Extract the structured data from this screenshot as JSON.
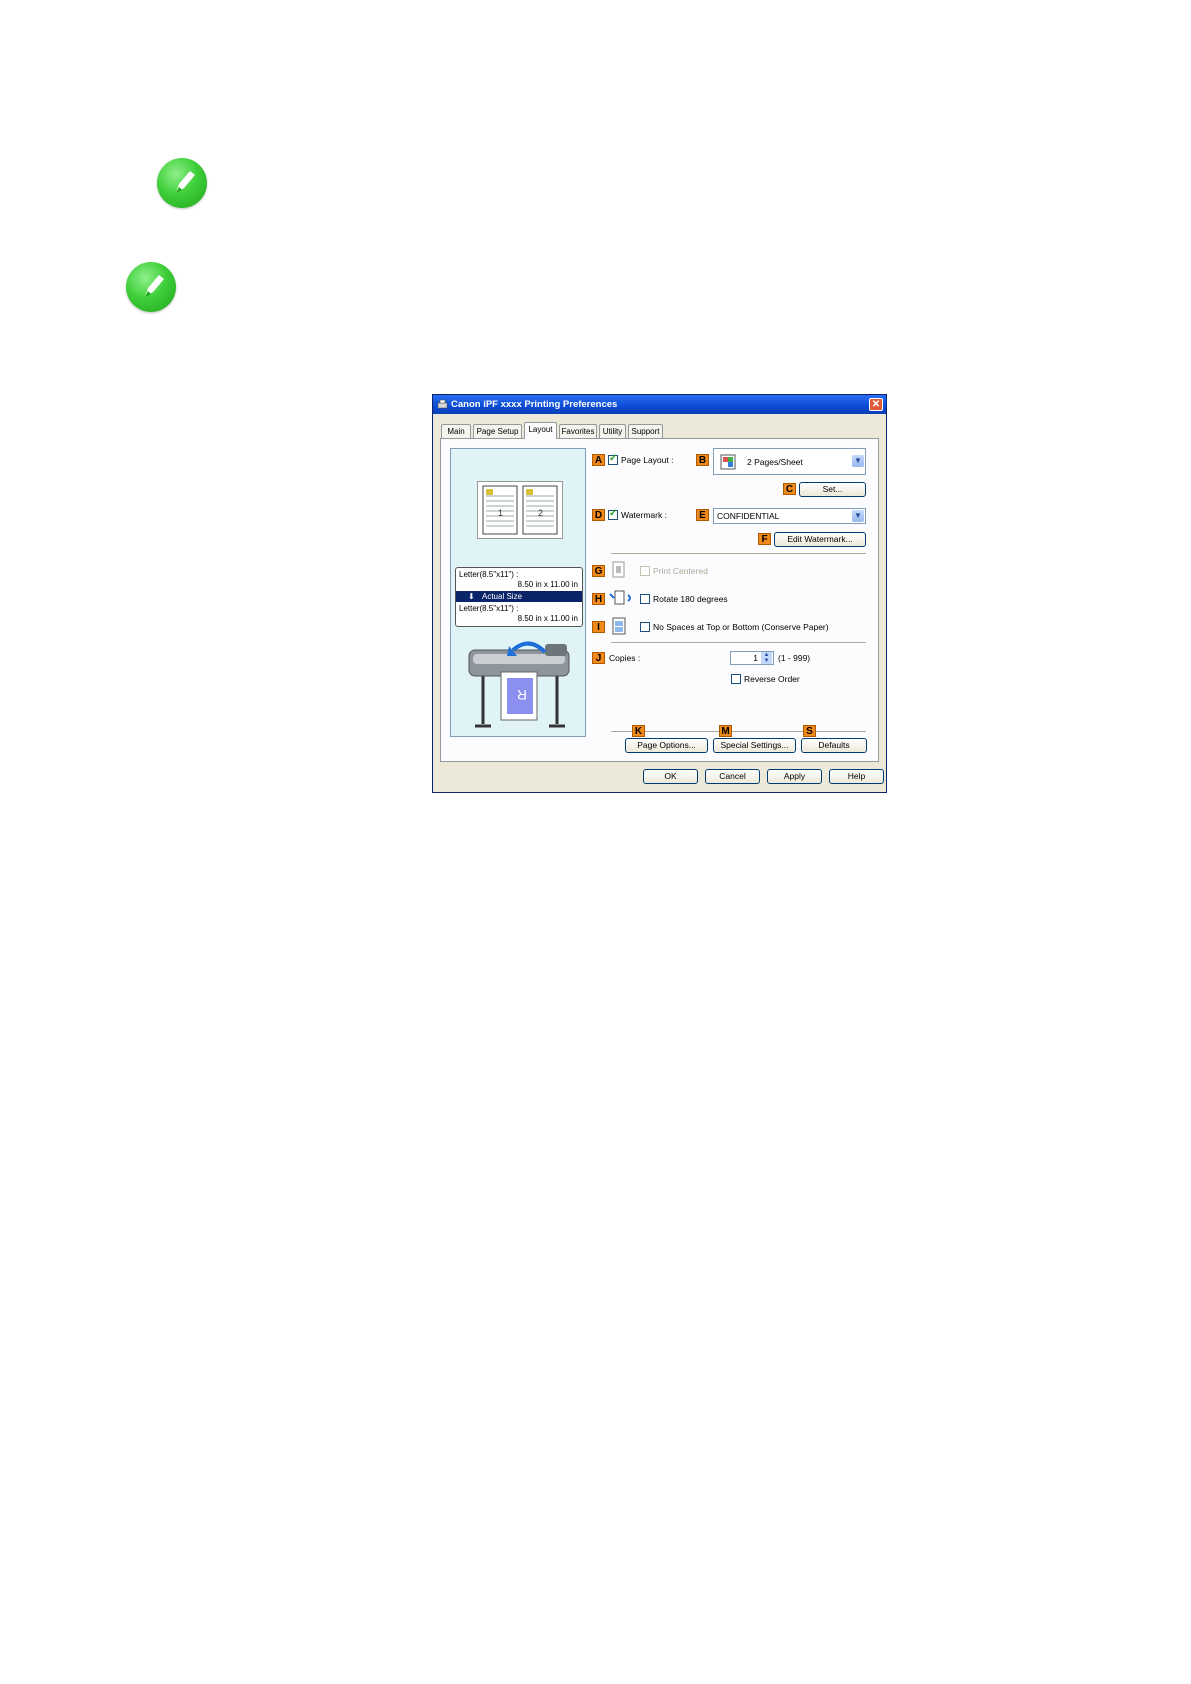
{
  "dialog": {
    "title": "Canon iPF xxxx Printing Preferences",
    "close_label": "✕",
    "tabs": [
      {
        "label": "Main"
      },
      {
        "label": "Page Setup"
      },
      {
        "label": "Layout"
      },
      {
        "label": "Favorites"
      },
      {
        "label": "Utility"
      },
      {
        "label": "Support"
      }
    ],
    "active_tab": "Layout",
    "preview": {
      "original_size": "Letter(8.5\"x11\") :",
      "original_dims": "8.50 in x 11.00 in",
      "scale_label": "Actual Size",
      "output_size": "Letter(8.5\"x11\") :",
      "output_dims": "8.50 in x 11.00 in"
    },
    "callouts": {
      "a": "A",
      "b": "B",
      "c": "C",
      "d": "D",
      "e": "E",
      "f": "F",
      "g": "G",
      "h": "H",
      "i": "I",
      "j": "J",
      "k": "K",
      "m": "M",
      "s": "S"
    },
    "page_layout": {
      "label": "Page Layout :",
      "checked": true,
      "value": "2 Pages/Sheet"
    },
    "set_button": "Set...",
    "watermark": {
      "label": "Watermark :",
      "checked": true,
      "value": "CONFIDENTIAL"
    },
    "edit_watermark_button": "Edit Watermark...",
    "print_centered": {
      "label": "Print Centered",
      "checked": false,
      "disabled": true
    },
    "rotate": {
      "label": "Rotate 180 degrees",
      "checked": false
    },
    "no_spaces": {
      "label": "No Spaces at Top or Bottom (Conserve Paper)",
      "checked": false
    },
    "copies": {
      "label": "Copies :",
      "value": "1",
      "range": "(1 - 999)"
    },
    "reverse_order": {
      "label": "Reverse Order",
      "checked": false
    },
    "page_options_button": "Page Options...",
    "special_settings_button": "Special Settings...",
    "defaults_button": "Defaults",
    "ok_button": "OK",
    "cancel_button": "Cancel",
    "apply_button": "Apply",
    "help_button": "Help"
  },
  "colors": {
    "callout": "#f08a1c",
    "title_bar": "#0b4bd6",
    "note_icon": "#3fcf3a"
  },
  "icons": [
    "note-pencil-icon",
    "printer-icon",
    "page-layout-icon",
    "print-centered-icon",
    "rotate-icon",
    "no-spaces-icon"
  ]
}
